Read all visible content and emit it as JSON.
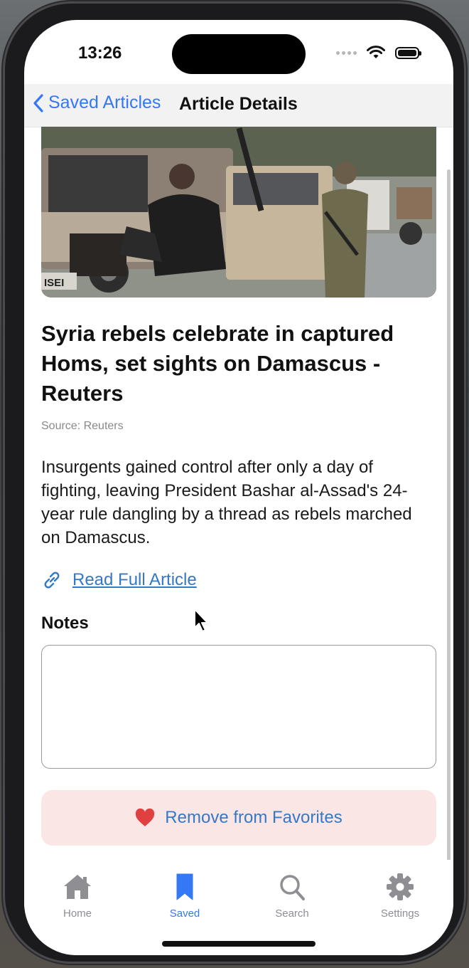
{
  "status": {
    "time": "13:26"
  },
  "nav": {
    "back_label": "Saved Articles",
    "title": "Article Details"
  },
  "article": {
    "headline": "Syria rebels celebrate in captured Homs, set sights on Damascus - Reuters",
    "source": "Source: Reuters",
    "summary": "Insurgents gained control after only a day of fighting, leaving President Bashar al-Assad's 24-year rule dangling by a thread as rebels marched on Damascus.",
    "image_text": "ISEI",
    "read_link_label": "Read Full Article"
  },
  "notes": {
    "label": "Notes",
    "value": ""
  },
  "favorite_button": {
    "label": "Remove from Favorites"
  },
  "tabs": [
    {
      "label": "Home",
      "icon": "house-icon",
      "active": false
    },
    {
      "label": "Saved",
      "icon": "bookmark-icon",
      "active": true
    },
    {
      "label": "Search",
      "icon": "search-icon",
      "active": false
    },
    {
      "label": "Settings",
      "icon": "gear-icon",
      "active": false
    }
  ],
  "colors": {
    "accent": "#3478f6",
    "link": "#3478c6",
    "heart": "#e0403f",
    "favorite_bg": "#fbe6e6",
    "inactive_tab": "#8e8e93"
  }
}
